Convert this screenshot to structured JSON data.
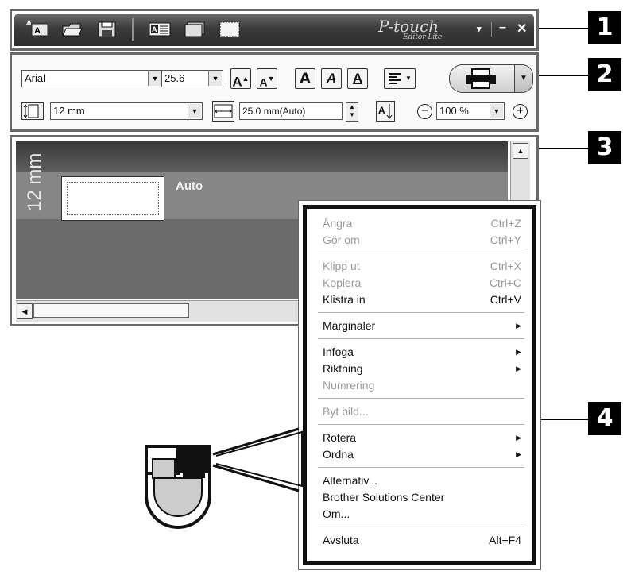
{
  "titlebar": {
    "brand": "P-touch",
    "brand_sub": "Editor Lite",
    "minimize_glyph": "–",
    "close_glyph": "✕",
    "dropdown_glyph": "▾",
    "icons": [
      "new-label-icon",
      "open-folder-icon",
      "save-disk-icon",
      "text-box-icon",
      "frame-icon",
      "dotted-frame-icon"
    ]
  },
  "toolbar": {
    "font_name": "Arial",
    "font_size": "25.6",
    "length_value": "12 mm",
    "width_value": "25.0 mm(Auto)",
    "zoom_value": "100 %",
    "text_buttons": [
      "A",
      "A",
      "A",
      "A",
      "A"
    ],
    "zoom_out_glyph": "−",
    "zoom_in_glyph": "+"
  },
  "canvas": {
    "tape_width_label": "12 mm",
    "auto_label": "Auto"
  },
  "context_menu": {
    "groups": [
      [
        {
          "label": "Ångra",
          "shortcut": "Ctrl+Z",
          "disabled": true
        },
        {
          "label": "Gör om",
          "shortcut": "Ctrl+Y",
          "disabled": true
        }
      ],
      [
        {
          "label": "Klipp ut",
          "shortcut": "Ctrl+X",
          "disabled": true
        },
        {
          "label": "Kopiera",
          "shortcut": "Ctrl+C",
          "disabled": true
        },
        {
          "label": "Klistra in",
          "shortcut": "Ctrl+V",
          "disabled": false
        }
      ],
      [
        {
          "label": "Marginaler",
          "submenu": true,
          "disabled": false
        }
      ],
      [
        {
          "label": "Infoga",
          "submenu": true,
          "disabled": false
        },
        {
          "label": "Riktning",
          "submenu": true,
          "disabled": false
        },
        {
          "label": "Numrering",
          "disabled": true
        }
      ],
      [
        {
          "label": "Byt bild...",
          "disabled": true
        }
      ],
      [
        {
          "label": "Rotera",
          "submenu": true,
          "disabled": false
        },
        {
          "label": "Ordna",
          "submenu": true,
          "disabled": false
        }
      ],
      [
        {
          "label": "Alternativ...",
          "disabled": false
        },
        {
          "label": "Brother Solutions Center",
          "disabled": false
        },
        {
          "label": "Om...",
          "disabled": false
        }
      ],
      [
        {
          "label": "Avsluta",
          "shortcut": "Alt+F4",
          "disabled": false
        }
      ]
    ]
  },
  "callouts": [
    "1",
    "2",
    "3",
    "4"
  ]
}
